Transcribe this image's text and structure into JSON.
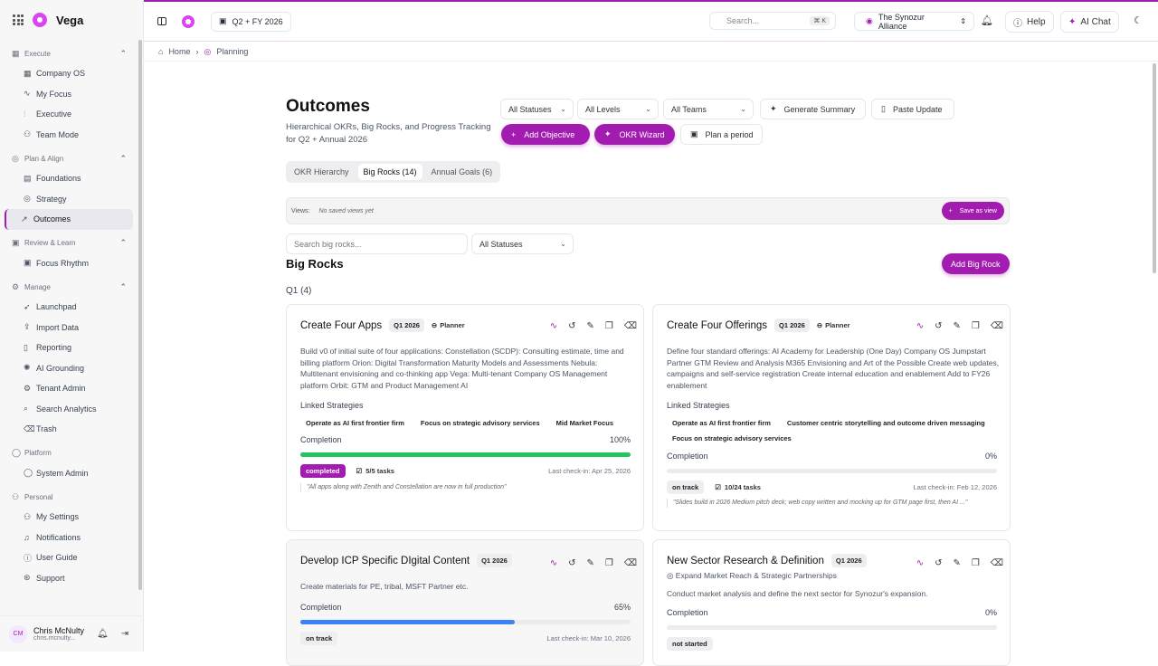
{
  "app": {
    "name": "Vega"
  },
  "header": {
    "period": "Q2 + FY 2026",
    "search_placeholder": "Search...",
    "search_shortcut": "⌘ K",
    "tenant": "The Synozur Alliance",
    "help": "Help",
    "ai_chat": "AI Chat"
  },
  "sidebar": {
    "sections": [
      {
        "label": "Execute",
        "items": [
          {
            "label": "Company OS"
          },
          {
            "label": "My Focus"
          },
          {
            "label": "Executive"
          },
          {
            "label": "Team Mode"
          }
        ]
      },
      {
        "label": "Plan & Align",
        "items": [
          {
            "label": "Foundations"
          },
          {
            "label": "Strategy"
          },
          {
            "label": "Outcomes"
          }
        ]
      },
      {
        "label": "Review & Learn",
        "items": [
          {
            "label": "Focus Rhythm"
          }
        ]
      },
      {
        "label": "Manage",
        "items": [
          {
            "label": "Launchpad"
          },
          {
            "label": "Import Data"
          },
          {
            "label": "Reporting"
          },
          {
            "label": "AI Grounding"
          },
          {
            "label": "Tenant Admin"
          },
          {
            "label": "Search Analytics"
          },
          {
            "label": "Trash"
          }
        ]
      },
      {
        "label": "Platform",
        "items": [
          {
            "label": "System Admin"
          }
        ]
      },
      {
        "label": "Personal",
        "items": [
          {
            "label": "My Settings"
          },
          {
            "label": "Notifications"
          },
          {
            "label": "User Guide"
          },
          {
            "label": "Support"
          }
        ]
      }
    ],
    "user": {
      "initials": "CM",
      "name": "Chris McNulty",
      "email": "chris.mcnulty..."
    }
  },
  "breadcrumb": {
    "home": "Home",
    "current": "Planning"
  },
  "page": {
    "title": "Outcomes",
    "subtitle": "Hierarchical OKRs, Big Rocks, and Progress Tracking for Q2 + Annual 2026"
  },
  "filters": {
    "statuses": "All Statuses",
    "levels": "All Levels",
    "teams": "All Teams"
  },
  "actions": {
    "generate_summary": "Generate Summary",
    "paste_update": "Paste Update",
    "add_objective": "Add Objective",
    "okr_wizard": "OKR Wizard",
    "plan_period": "Plan a period"
  },
  "tabs": [
    {
      "label": "OKR Hierarchy"
    },
    {
      "label": "Big Rocks (14)"
    },
    {
      "label": "Annual Goals (6)"
    }
  ],
  "views": {
    "label": "Views:",
    "empty": "No saved views yet",
    "save": "Save as view"
  },
  "bigrocks": {
    "search_placeholder": "Search big rocks...",
    "status_filter": "All Statuses",
    "heading": "Big Rocks",
    "add": "Add Big Rock",
    "group": "Q1 (4)"
  },
  "cards": [
    {
      "title": "Create Four Apps",
      "quarter": "Q1 2026",
      "planner": "Planner",
      "description": "Build v0 of initial suite of four applications: Constellation (SCDP): Consulting estimate, time and billing platform Orion: Digital Transformation Maturity Models and Assessments Nebula: Multitenant envisioning and co-thinking app Vega: Multi-tenant Company OS Management platform Orbit: GTM and Product Management AI",
      "linked_label": "Linked Strategies",
      "strategies": [
        "Operate as AI first frontier firm",
        "Focus on strategic advisory services",
        "Mid Market Focus"
      ],
      "completion_label": "Completion",
      "completion": "100%",
      "progress": 100,
      "status": "completed",
      "tasks": "5/5 tasks",
      "last_checkin": "Last check-in: Apr 25, 2026",
      "note": "\"All apps along with Zenith and Constellation are now in full production\""
    },
    {
      "title": "Create Four Offerings",
      "quarter": "Q1 2026",
      "planner": "Planner",
      "description": "Define four standard offerings: AI Academy for Leadership (One Day) Company OS Jumpstart Partner GTM Review and Analysis M365 Envisioning and Art of the Possible Create web updates, campaigns and self-service registration Create internal education and enablement Add to FY26 enablement",
      "linked_label": "Linked Strategies",
      "strategies": [
        "Operate as AI first frontier firm",
        "Customer centric storytelling and outcome driven messaging",
        "Focus on strategic advisory services"
      ],
      "completion_label": "Completion",
      "completion": "0%",
      "progress": 0,
      "status": "on track",
      "tasks": "10/24 tasks",
      "last_checkin": "Last check-in: Feb 12, 2026",
      "note": "\"Slides build in 2026 Medium pitch deck; web copy written and mocking up for GTM page first, then AI ...\""
    },
    {
      "title": "Develop ICP Specific DIgital Content",
      "quarter": "Q1 2026",
      "description": "Create materials for PE, tribal, MSFT Partner etc.",
      "completion_label": "Completion",
      "completion": "65%",
      "progress": 65,
      "status": "on track",
      "last_checkin": "Last check-in: Mar 10, 2026"
    },
    {
      "title": "New Sector Research & Definition",
      "quarter": "Q1 2026",
      "objective": "Expand Market Reach & Strategic Partnerships",
      "description": "Conduct market analysis and define the next sector for Synozur's expansion.",
      "completion_label": "Completion",
      "completion": "0%",
      "progress": 0,
      "status": "not started"
    }
  ],
  "colors": {
    "accent": "#a21caf",
    "complete": "#22c55e",
    "progress": "#3b82f6"
  }
}
